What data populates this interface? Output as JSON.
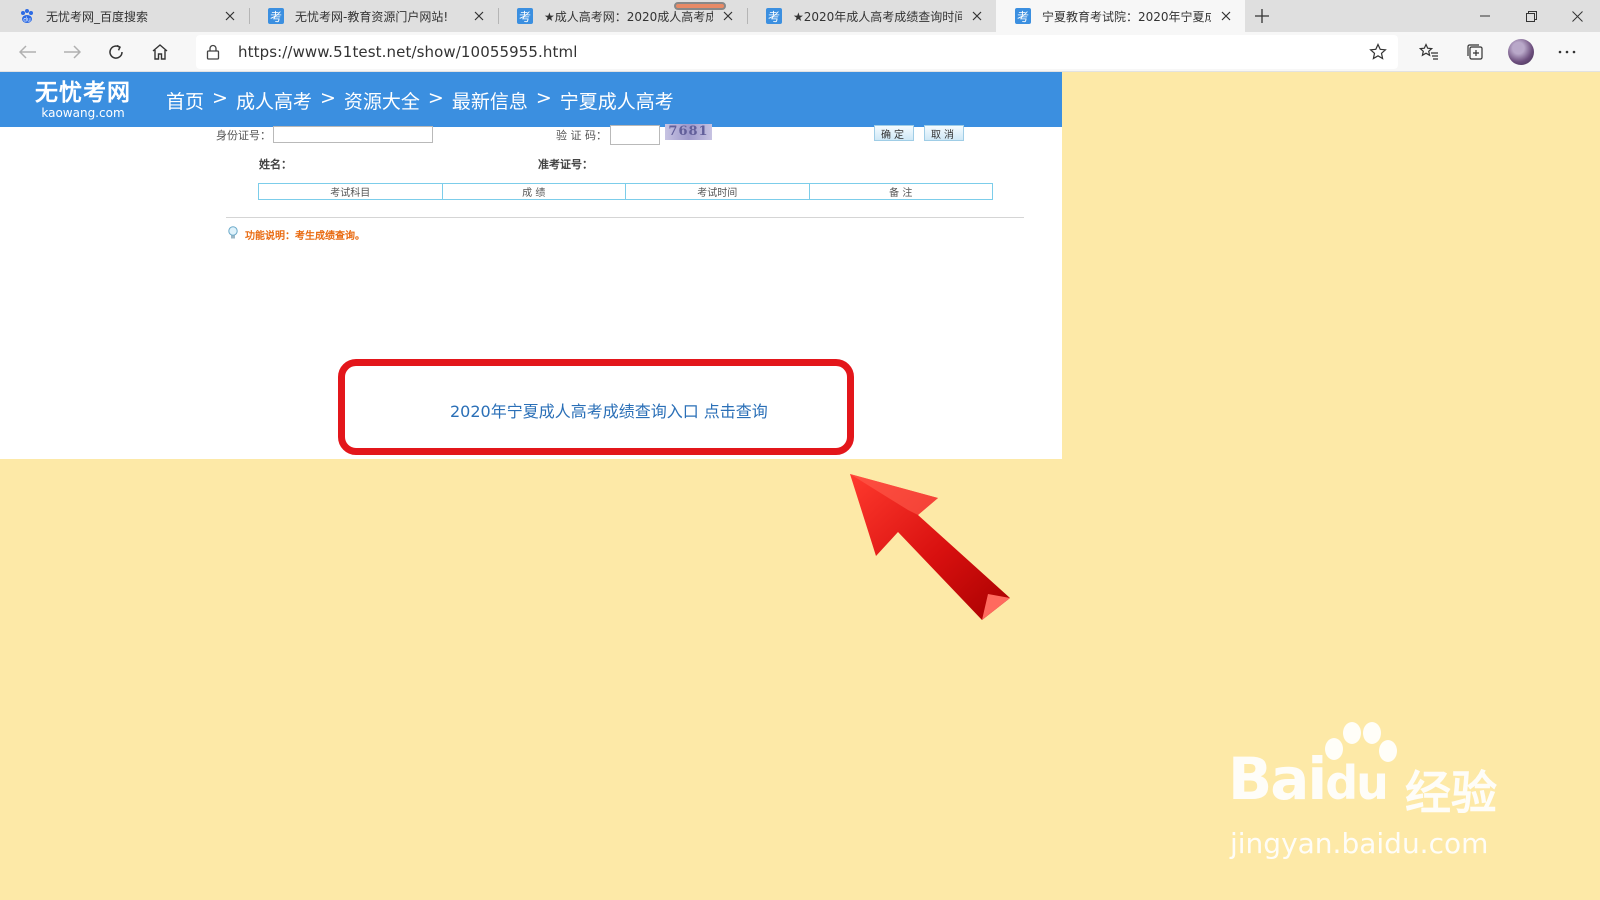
{
  "browser": {
    "tabs": [
      {
        "title": "无忧考网_百度搜索",
        "icon": "baidu-paw-icon",
        "active": false
      },
      {
        "title": "无忧考网-教育资源门户网站!",
        "icon": "kao-icon",
        "active": false
      },
      {
        "title": "★成人高考网：2020成人高考成",
        "icon": "kao-icon",
        "active": false
      },
      {
        "title": "★2020年成人高考成绩查询时间",
        "icon": "kao-icon",
        "active": false
      },
      {
        "title": "宁夏教育考试院：2020年宁夏成",
        "icon": "kao-icon",
        "active": true
      }
    ],
    "new_tab_label": "+",
    "address": "https://www.51test.net/show/10055955.html"
  },
  "site": {
    "logo_cn": "无忧考网",
    "logo_en": "kaowang.com",
    "breadcrumb": [
      "首页",
      "成人高考",
      "资源大全",
      "最新信息",
      "宁夏成人高考"
    ],
    "breadcrumb_sep": ">"
  },
  "form": {
    "id_label": "身份证号：",
    "captcha_label": "验 证 码：",
    "captcha_code": "7681",
    "ok_label": "确定",
    "cancel_label": "取消",
    "name_label": "姓名：",
    "ticket_label": "准考证号："
  },
  "result_table": {
    "headers": [
      "考试科目",
      "成 绩",
      "考试时间",
      "备 注"
    ]
  },
  "note": "功能说明：考生成绩查询。",
  "query_link": "2020年宁夏成人高考成绩查询入口 点击查询",
  "watermark": {
    "brand": "Bai",
    "brand_tail": "du",
    "cn": "经验",
    "url": "jingyan.baidu.com"
  },
  "colors": {
    "header_blue": "#3b8fe0",
    "highlight_red": "#e3161b",
    "background_yellow": "#fde9a7",
    "link_blue": "#2a6fb7",
    "note_orange": "#e96b12"
  }
}
